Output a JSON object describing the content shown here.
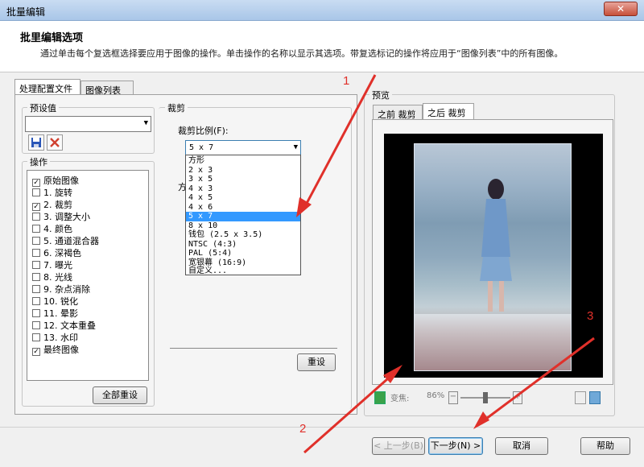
{
  "window": {
    "title": "批量编辑",
    "close_glyph": "✕"
  },
  "header": {
    "title": "批里编辑选项",
    "description": "通过单击每个复选框选择要应用于图像的操作。单击操作的名称以显示其选项。带复选标记的操作将应用于“图像列表”中的所有图像。"
  },
  "tabs": [
    {
      "label": "处理配置文件",
      "active": true
    },
    {
      "label": "图像列表",
      "active": false
    }
  ],
  "presets": {
    "label": "预设值",
    "value": "",
    "save_icon": "save-icon",
    "delete_icon": "delete-icon"
  },
  "operations": {
    "label": "操作",
    "items": [
      {
        "label": "原始图像",
        "checked": true
      },
      {
        "label": "1.  旋转",
        "checked": false
      },
      {
        "label": "2.  裁剪",
        "checked": true
      },
      {
        "label": "3.  调整大小",
        "checked": false
      },
      {
        "label": "4.  颜色",
        "checked": false
      },
      {
        "label": "5.  通道混合器",
        "checked": false
      },
      {
        "label": "6.  深褐色",
        "checked": false
      },
      {
        "label": "7.  曝光",
        "checked": false
      },
      {
        "label": "8.  光线",
        "checked": false
      },
      {
        "label": "9.  杂点消除",
        "checked": false
      },
      {
        "label": "10.  锐化",
        "checked": false
      },
      {
        "label": "11.  晕影",
        "checked": false
      },
      {
        "label": "12.  文本重叠",
        "checked": false
      },
      {
        "label": "13.  水印",
        "checked": false
      },
      {
        "label": "最终图像",
        "checked": true
      }
    ],
    "reset_all_label": "全部重设"
  },
  "crop": {
    "label": "裁剪",
    "ratio_label": "裁剪比例(F):",
    "ratio_value": "5 x 7",
    "hidden_label": "方",
    "options": [
      "方形",
      "2 x 3",
      "3 x 5",
      "4 x 3",
      "4 x 5",
      "4 x 6",
      "5 x 7",
      "8 x 10",
      "钱包 (2.5 x 3.5)",
      "NTSC (4:3)",
      "PAL (5:4)",
      "宽银幕 (16:9)",
      "自定义..."
    ],
    "selected_index": 6,
    "reset_label": "重设"
  },
  "preview": {
    "label": "预览",
    "tabs": [
      {
        "label": "之前 裁剪",
        "active": false
      },
      {
        "label": "之后 裁剪",
        "active": true
      }
    ],
    "zoom_label": "变焦:",
    "zoom_value": "86%",
    "zoom_level": 0.5
  },
  "footer": {
    "prev_label": "< 上一步(B)",
    "next_label": "下一步(N) >",
    "cancel_label": "取消",
    "help_label": "帮助"
  },
  "annotations": [
    "1",
    "2",
    "3"
  ],
  "colors": {
    "accent": "#3399ff",
    "annotation": "#e0302a",
    "title_bar": "#a9c6e8"
  }
}
